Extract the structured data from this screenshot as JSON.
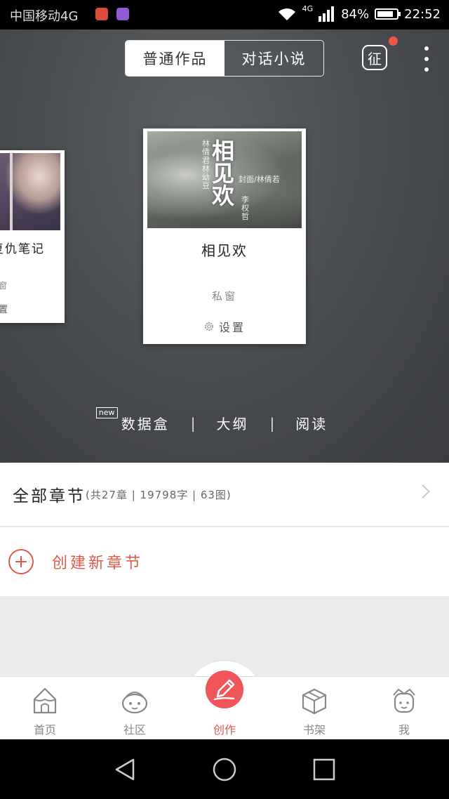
{
  "status_bar": {
    "carrier": "中国移动4G",
    "network": "4G",
    "battery": "84%",
    "battery_level": 0.84,
    "time": "22:52"
  },
  "header": {
    "tabs": [
      {
        "label": "普通作品",
        "active": true
      },
      {
        "label": "对话小说",
        "active": false
      }
    ],
    "badge_label": "征"
  },
  "cards": {
    "center": {
      "title": "相见欢",
      "author": "私窗",
      "settings_label": "设置",
      "cover_title": "相见欢",
      "cover_credit": "封面/林倩若",
      "cover_cast": "林倩君林幼豆",
      "cover_writer": "李权哲"
    },
    "left": {
      "title": "复仇笔记",
      "author": "窗",
      "settings_label": "置"
    }
  },
  "actions": {
    "new_badge": "new",
    "items": [
      "数据盒",
      "大纲",
      "阅读"
    ]
  },
  "chapters": {
    "label": "全部章节",
    "detail": "(共27章 | 19798字 | 63图)"
  },
  "create": {
    "label": "创建新章节"
  },
  "tabbar": [
    {
      "label": "首页",
      "icon": "home-tent-icon"
    },
    {
      "label": "社区",
      "icon": "community-face-icon"
    },
    {
      "label": "创作",
      "icon": "pen-icon",
      "active": true
    },
    {
      "label": "书架",
      "icon": "bookshelf-box-icon"
    },
    {
      "label": "我",
      "icon": "profile-face-icon"
    }
  ],
  "colors": {
    "accent": "#e05a4c",
    "fab": "#f0555a",
    "hero_bg": "#4b4e51"
  }
}
